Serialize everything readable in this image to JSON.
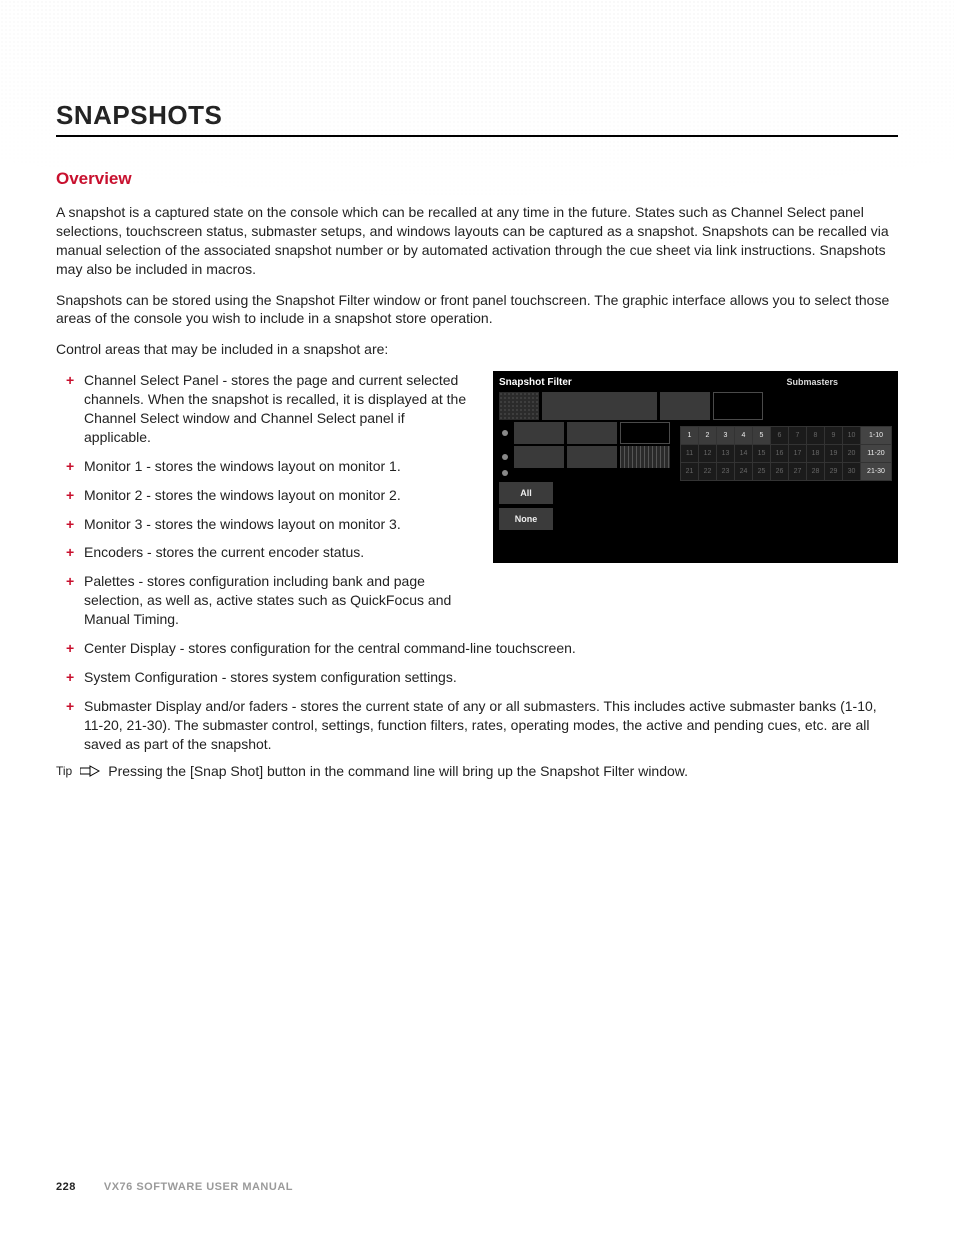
{
  "heading": "SNAPSHOTS",
  "subheading": "Overview",
  "paragraphs": [
    "A snapshot is a captured state on the console which can be recalled at any time in the future. States such as Channel Select panel selections, touchscreen status, submaster setups, and windows layouts can be captured as a snapshot. Snapshots can be recalled via manual selection of the associated snapshot number or by automated activation through the cue sheet via link instructions. Snapshots may also be included in macros.",
    "Snapshots can be stored using the Snapshot Filter window or front panel touchscreen. The graphic interface allows you to select those areas of the console you wish to include in a snapshot store operation.",
    "Control areas that may be included in a snapshot are:"
  ],
  "items_left": [
    "Channel Select Panel - stores the page and current selected channels. When the snapshot is recalled, it is displayed at the Channel Select window and Channel Select panel if applicable.",
    "Monitor 1 - stores the windows layout on monitor 1.",
    "Monitor 2 - stores the windows layout on monitor 2.",
    "Monitor 3 - stores the windows layout on monitor 3.",
    "Encoders - stores the current encoder status.",
    "Palettes - stores configuration including bank and page selection, as well as, active states such as QuickFocus and Manual Timing."
  ],
  "items_full": [
    "Center Display - stores configuration for the central command-line touchscreen.",
    "System Configuration - stores system configuration settings.",
    "Submaster Display and/or faders - stores the current state of any or all submasters. This includes active submaster banks (1-10, 11-20, 21-30). The submaster control, settings, function filters, rates, operating modes, the active and pending cues, etc. are all saved as part of the snapshot."
  ],
  "tip": {
    "label": "Tip",
    "text": "Pressing the [Snap Shot] button in the command line will bring up the Snapshot Filter window."
  },
  "snapshot_filter": {
    "title": "Snapshot Filter",
    "submasters_label": "Submasters",
    "all": "All",
    "none": "None",
    "ranges": [
      "1-10",
      "11-20",
      "21-30"
    ],
    "grid": [
      [
        "1",
        "2",
        "3",
        "4",
        "5",
        "6",
        "7",
        "8",
        "9",
        "10"
      ],
      [
        "11",
        "12",
        "13",
        "14",
        "15",
        "16",
        "17",
        "18",
        "19",
        "20"
      ],
      [
        "21",
        "22",
        "23",
        "24",
        "25",
        "26",
        "27",
        "28",
        "29",
        "30"
      ]
    ],
    "active_count": 5
  },
  "footer": {
    "page": "228",
    "manual": "VX76 SOFTWARE USER MANUAL"
  }
}
